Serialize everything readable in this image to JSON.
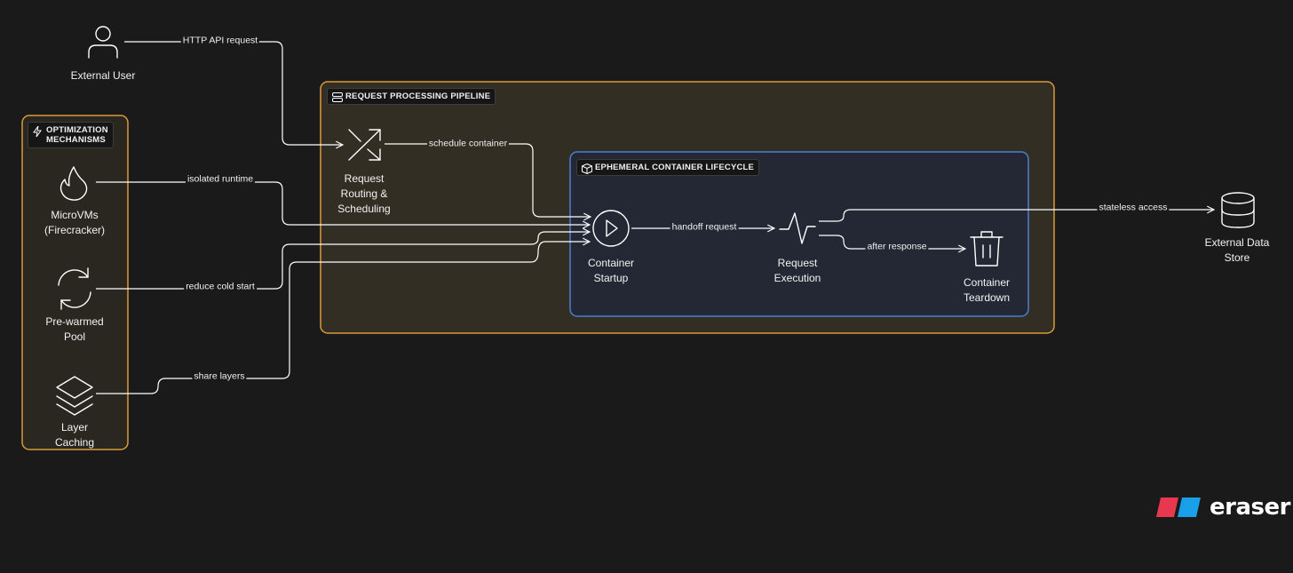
{
  "groups": {
    "optimization": {
      "title_line1": "OPTIMIZATION",
      "title_line2": "MECHANISMS",
      "color": "#d99a3a"
    },
    "pipeline": {
      "title": "REQUEST PROCESSING PIPELINE",
      "color": "#d99a3a"
    },
    "lifecycle": {
      "title": "EPHEMERAL CONTAINER LIFECYCLE",
      "color": "#4a7fd4"
    }
  },
  "nodes": {
    "external_user": {
      "label": "External User",
      "icon": "user-icon"
    },
    "routing": {
      "label_line1": "Request",
      "label_line2": "Routing &",
      "label_line3": "Scheduling",
      "icon": "shuffle-icon"
    },
    "microvms": {
      "label_line1": "MicroVMs",
      "label_line2": "(Firecracker)",
      "icon": "flame-icon"
    },
    "prewarmed": {
      "label_line1": "Pre-warmed",
      "label_line2": "Pool",
      "icon": "refresh-icon"
    },
    "layer_caching": {
      "label_line1": "Layer",
      "label_line2": "Caching",
      "icon": "layers-icon"
    },
    "startup": {
      "label_line1": "Container",
      "label_line2": "Startup",
      "icon": "play-icon"
    },
    "execution": {
      "label_line1": "Request",
      "label_line2": "Execution",
      "icon": "activity-icon"
    },
    "teardown": {
      "label_line1": "Container",
      "label_line2": "Teardown",
      "icon": "trash-icon"
    },
    "datastore": {
      "label_line1": "External Data",
      "label_line2": "Store",
      "icon": "database-icon"
    }
  },
  "edges": {
    "http_api": "HTTP API request",
    "schedule": "schedule container",
    "isolated": "isolated runtime",
    "cold_start": "reduce cold start",
    "share_layers": "share layers",
    "handoff": "handoff request",
    "stateless": "stateless access",
    "after_response": "after response"
  },
  "brand": {
    "name": "eraser",
    "color_red": "#e8384f",
    "color_blue": "#1aa0e8"
  }
}
